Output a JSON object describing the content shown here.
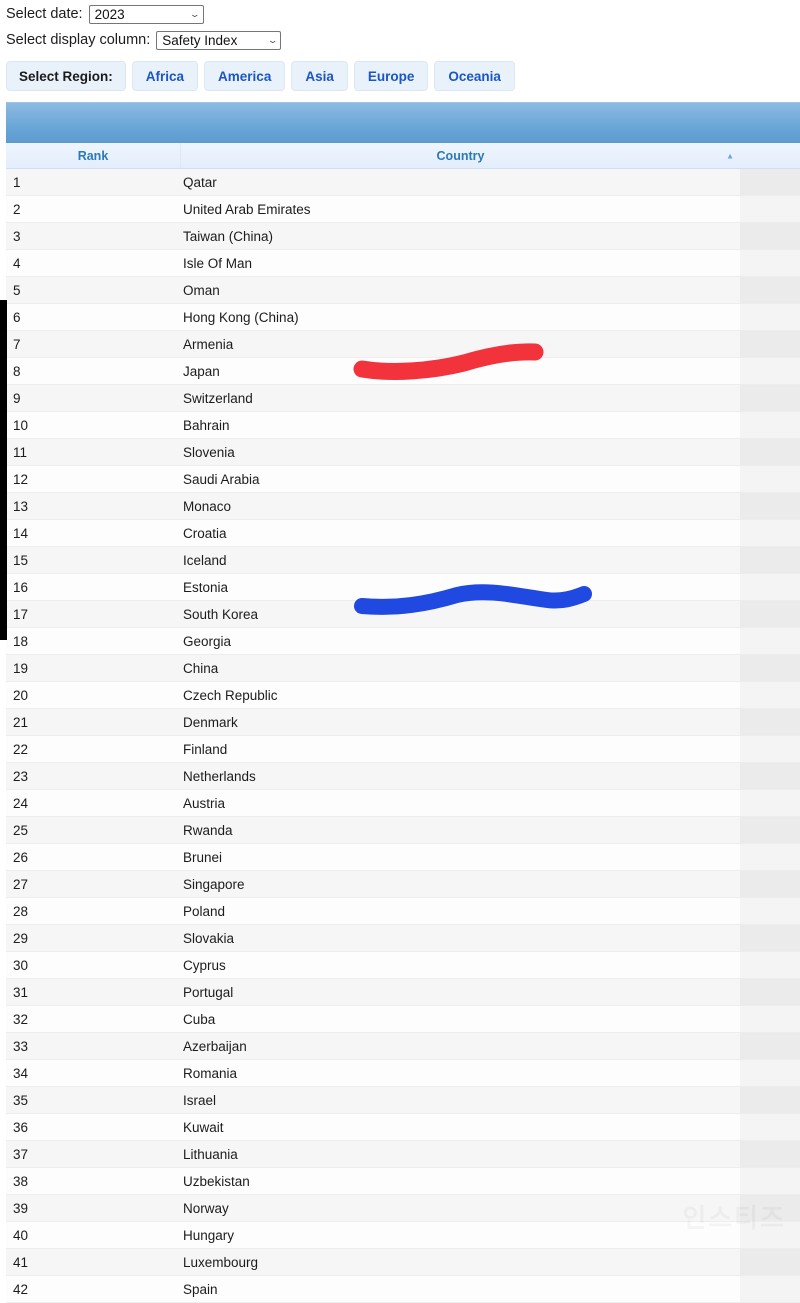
{
  "controls": {
    "date_label": "Select date:",
    "date_value": "2023",
    "column_label": "Select display column:",
    "column_value": "Safety Index",
    "caret_glyph": "⌄"
  },
  "region_bar": {
    "label": "Select Region:",
    "buttons": [
      "Africa",
      "America",
      "Asia",
      "Europe",
      "Oceania"
    ]
  },
  "table": {
    "columns": [
      "Rank",
      "Country",
      ""
    ],
    "sort_caret": "▲",
    "rows": [
      {
        "rank": "1",
        "country": "Qatar"
      },
      {
        "rank": "2",
        "country": "United Arab Emirates"
      },
      {
        "rank": "3",
        "country": "Taiwan (China)"
      },
      {
        "rank": "4",
        "country": "Isle Of Man"
      },
      {
        "rank": "5",
        "country": "Oman"
      },
      {
        "rank": "6",
        "country": "Hong Kong (China)"
      },
      {
        "rank": "7",
        "country": "Armenia"
      },
      {
        "rank": "8",
        "country": "Japan"
      },
      {
        "rank": "9",
        "country": "Switzerland"
      },
      {
        "rank": "10",
        "country": "Bahrain"
      },
      {
        "rank": "11",
        "country": "Slovenia"
      },
      {
        "rank": "12",
        "country": "Saudi Arabia"
      },
      {
        "rank": "13",
        "country": "Monaco"
      },
      {
        "rank": "14",
        "country": "Croatia"
      },
      {
        "rank": "15",
        "country": "Iceland"
      },
      {
        "rank": "16",
        "country": "Estonia"
      },
      {
        "rank": "17",
        "country": "South Korea"
      },
      {
        "rank": "18",
        "country": "Georgia"
      },
      {
        "rank": "19",
        "country": "China"
      },
      {
        "rank": "20",
        "country": "Czech Republic"
      },
      {
        "rank": "21",
        "country": "Denmark"
      },
      {
        "rank": "22",
        "country": "Finland"
      },
      {
        "rank": "23",
        "country": "Netherlands"
      },
      {
        "rank": "24",
        "country": "Austria"
      },
      {
        "rank": "25",
        "country": "Rwanda"
      },
      {
        "rank": "26",
        "country": "Brunei"
      },
      {
        "rank": "27",
        "country": "Singapore"
      },
      {
        "rank": "28",
        "country": "Poland"
      },
      {
        "rank": "29",
        "country": "Slovakia"
      },
      {
        "rank": "30",
        "country": "Cyprus"
      },
      {
        "rank": "31",
        "country": "Portugal"
      },
      {
        "rank": "32",
        "country": "Cuba"
      },
      {
        "rank": "33",
        "country": "Azerbaijan"
      },
      {
        "rank": "34",
        "country": "Romania"
      },
      {
        "rank": "35",
        "country": "Israel"
      },
      {
        "rank": "36",
        "country": "Kuwait"
      },
      {
        "rank": "37",
        "country": "Lithuania"
      },
      {
        "rank": "38",
        "country": "Uzbekistan"
      },
      {
        "rank": "39",
        "country": "Norway"
      },
      {
        "rank": "40",
        "country": "Hungary"
      },
      {
        "rank": "41",
        "country": "Luxembourg"
      },
      {
        "rank": "42",
        "country": "Spain"
      }
    ]
  },
  "annotations": [
    {
      "name": "red-highlight-stroke",
      "color": "#f2333c",
      "near_row": "8"
    },
    {
      "name": "blue-highlight-stroke",
      "color": "#1f49e0",
      "near_row": "17"
    }
  ],
  "watermark": {
    "text": "인스티즈"
  },
  "colors": {
    "banner_top": "#8cbbe2",
    "banner_bottom": "#5d9bcf",
    "header_text": "#2a7ab8",
    "region_button_bg": "#e9f1fb",
    "region_button_text": "#1a56c4",
    "red_mark": "#f2333c",
    "blue_mark": "#1f49e0",
    "scrollbar_thumb": "#000000"
  }
}
